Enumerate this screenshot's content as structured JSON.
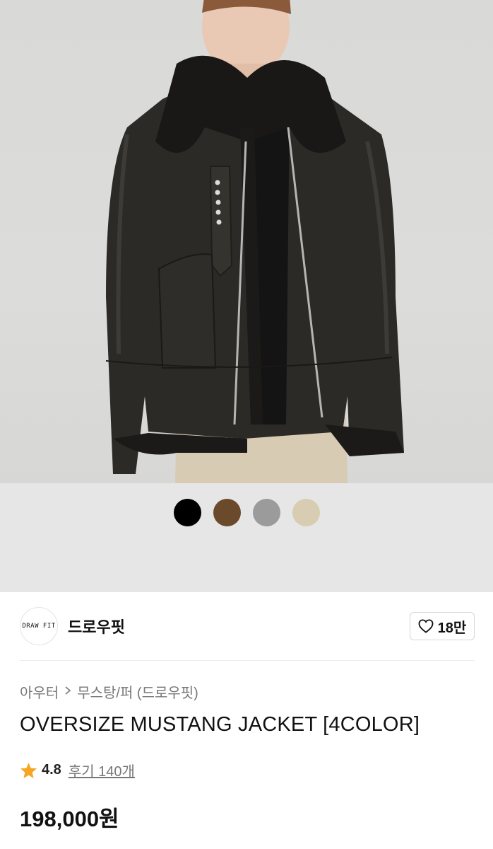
{
  "product": {
    "image_alt": "Model wearing oversize black leather mustang jacket with fur collar",
    "color_options": [
      {
        "name": "black",
        "hex": "#000000"
      },
      {
        "name": "brown",
        "hex": "#6b4a2b"
      },
      {
        "name": "gray",
        "hex": "#9b9b9b"
      },
      {
        "name": "beige",
        "hex": "#d8cdb2"
      }
    ],
    "brand": {
      "logo_text": "DRAW FIT",
      "name": "드로우핏"
    },
    "likes": {
      "count": "18만",
      "icon": "heart-icon"
    },
    "breadcrumb": {
      "category": "아우터",
      "subcategory": "무스탕/퍼 (드로우핏)",
      "separator_icon": "chevron-right-icon"
    },
    "title": "OVERSIZE MUSTANG JACKET [4COLOR]",
    "rating": {
      "icon": "star-icon",
      "score": "4.8",
      "reviews_label": "후기 140개",
      "star_color": "#f5a623"
    },
    "price": "198,000원"
  }
}
